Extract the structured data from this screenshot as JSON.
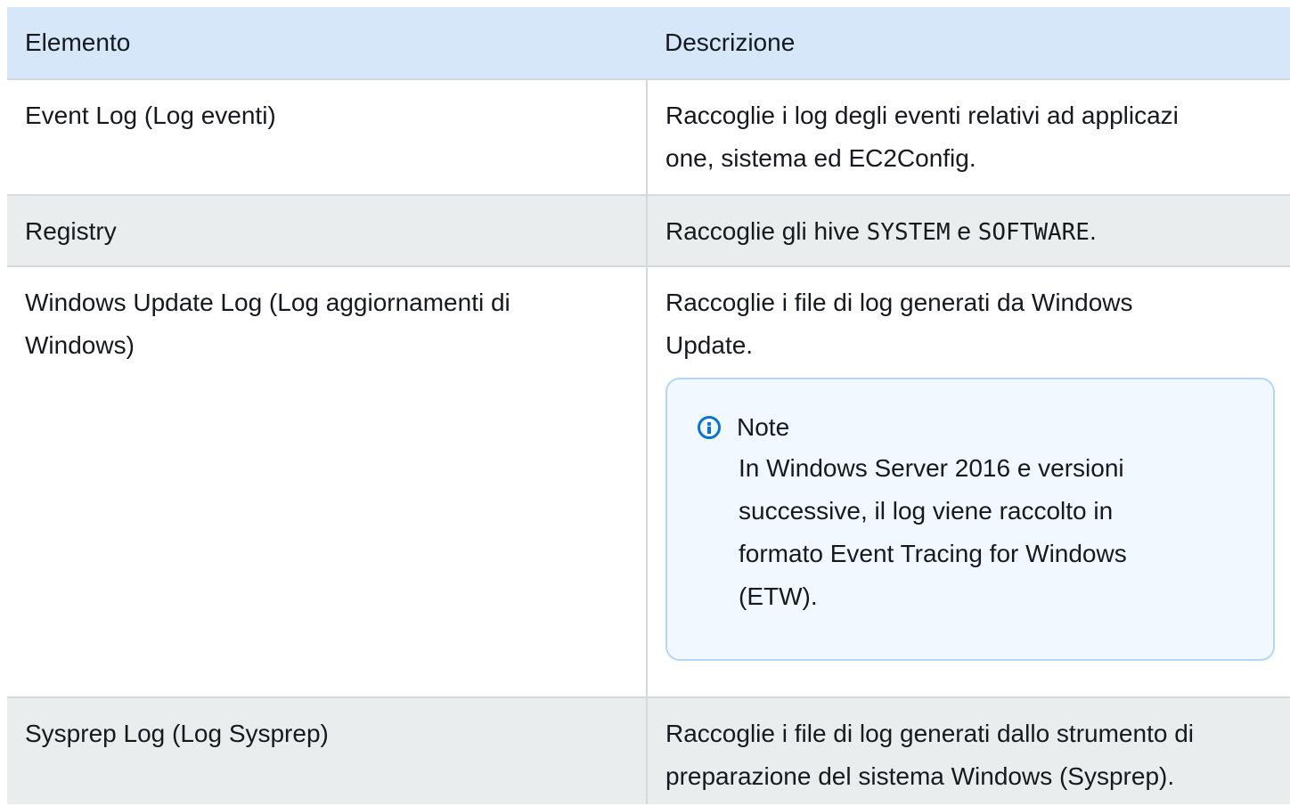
{
  "table": {
    "headers": [
      "Elemento",
      "Descrizione"
    ],
    "rows": [
      {
        "element": "Event Log (Log eventi)",
        "desc_line1": "Raccoglie i log degli eventi relativi ad applicazi",
        "desc_line2": "one, sistema ed EC2Config."
      },
      {
        "element": "Registry",
        "desc_prefix": "Raccoglie gli hive ",
        "code1": "SYSTEM",
        "desc_mid": " e ",
        "code2": "SOFTWARE",
        "desc_suffix": "."
      },
      {
        "element_line1": "Windows Update Log (Log aggiornamenti di",
        "element_line2": "Windows)",
        "desc_line1": "Raccoglie i file di log generati da Windows",
        "desc_line2": "Update.",
        "note": {
          "icon": "info-icon",
          "title": "Note",
          "line1": "In Windows Server 2016 e versioni",
          "line2": "successive, il log viene raccolto in",
          "line3": "formato Event Tracing for Windows",
          "line4": "(ETW)."
        }
      },
      {
        "element": "Sysprep Log (Log Sysprep)",
        "desc_line1": "Raccoglie i file di log generati dallo strumento di",
        "desc_line2": "preparazione del sistema Windows (Sysprep)."
      }
    ]
  },
  "colors": {
    "header_bg": "#d5e7f8",
    "alt_row_bg": "#eaeded",
    "note_bg": "#f1f8ff",
    "note_border": "#b3d7f6",
    "info_blue": "#0972d3"
  }
}
